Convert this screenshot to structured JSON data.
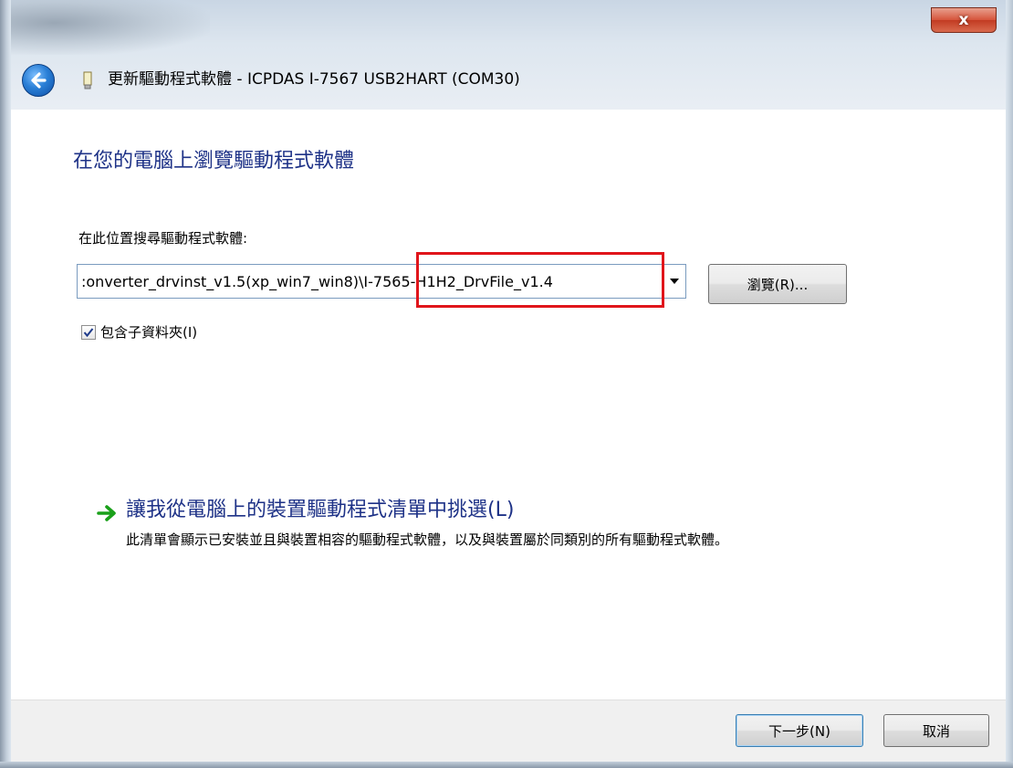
{
  "window": {
    "close_label": "x",
    "title": "更新驅動程式軟體 - ICPDAS I-7567 USB2HART (COM30)"
  },
  "page": {
    "heading": "在您的電腦上瀏覽驅動程式軟體",
    "location_label": "在此位置搜尋驅動程式軟體:",
    "path_value": ":onverter_drvinst_v1.5(xp_win7_win8)\\I-7565-H1H2_DrvFile_v1.4",
    "browse_label": "瀏覽(R)...",
    "include_subfolders_label": "包含子資料夾(I)",
    "include_subfolders_checked": true,
    "pick_title": "讓我從電腦上的裝置驅動程式清單中挑選(L)",
    "pick_description": "此清單會顯示已安裝並且與裝置相容的驅動程式軟體，以及與裝置屬於同類別的所有驅動程式軟體。"
  },
  "footer": {
    "next_label": "下一步(N)",
    "cancel_label": "取消"
  },
  "colors": {
    "heading": "#1e3287",
    "highlight": "#e0151b",
    "pick_arrow": "#1aa01a"
  },
  "icons": {
    "back": "back-arrow-icon",
    "device": "usb-device-icon",
    "dropdown": "chevron-down-icon",
    "check": "checkmark-icon",
    "pick": "green-arrow-icon"
  }
}
